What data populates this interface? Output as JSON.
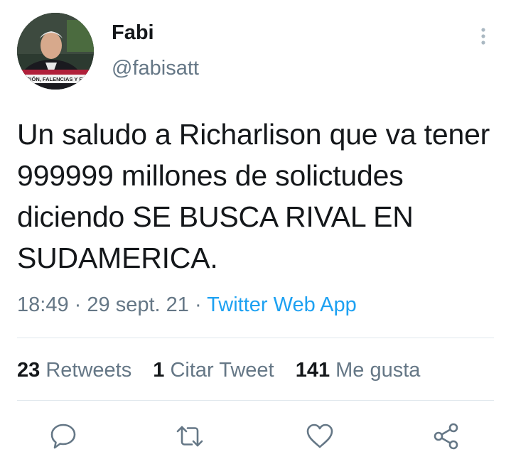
{
  "author": {
    "display_name": "Fabi",
    "handle": "@fabisatt",
    "avatar_icon": "profile-photo",
    "avatar_caption": "EPCIÓN, FALENCIAS Y FRUSTRA"
  },
  "tweet": {
    "text": "Un saludo a Richarlison que va tener 999999 millones de solictudes diciendo SE BUSCA RIVAL EN SUDAMERICA.",
    "time": "18:49",
    "date": "29 sept. 21",
    "separator": "·",
    "source": "Twitter Web App"
  },
  "stats": {
    "retweets_count": "23",
    "retweets_label": "Retweets",
    "quotes_count": "1",
    "quotes_label": "Citar Tweet",
    "likes_count": "141",
    "likes_label": "Me gusta"
  },
  "actions": [
    "reply-icon",
    "retweet-icon",
    "like-icon",
    "share-icon"
  ],
  "colors": {
    "text": "#14171a",
    "secondary": "#657786",
    "link": "#1da1f2",
    "divider": "#e1e8ed"
  }
}
